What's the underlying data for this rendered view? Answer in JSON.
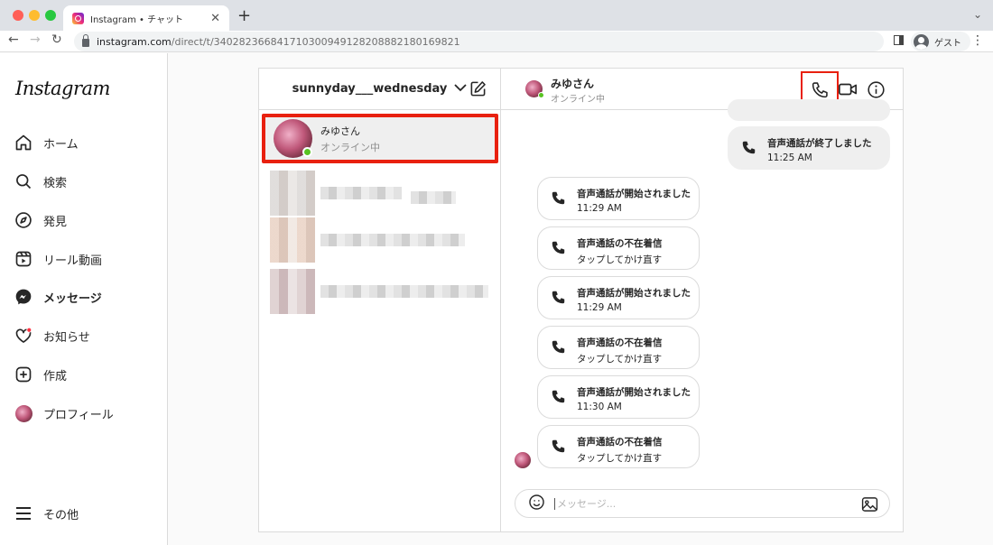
{
  "browser": {
    "tab_title": "Instagram • チャット",
    "tab_close": "✕",
    "new_tab": "+",
    "url_host": "instagram.com",
    "url_path": "/direct/t/340282366841710300949128208882180169821",
    "guest_label": "ゲスト"
  },
  "nav": {
    "logo": "Instagram",
    "items": [
      {
        "label": "ホーム",
        "icon": "home-icon"
      },
      {
        "label": "検索",
        "icon": "search-icon"
      },
      {
        "label": "発見",
        "icon": "compass-icon"
      },
      {
        "label": "リール動画",
        "icon": "reels-icon"
      },
      {
        "label": "メッセージ",
        "icon": "messenger-icon"
      },
      {
        "label": "お知らせ",
        "icon": "heart-icon"
      },
      {
        "label": "作成",
        "icon": "plus-square-icon"
      },
      {
        "label": "プロフィール",
        "icon": "profile-avatar"
      }
    ],
    "more_label": "その他"
  },
  "inbox": {
    "username": "sunnyday___wednesday",
    "threads": [
      {
        "name": "みゆさん",
        "status": "オンライン中"
      }
    ]
  },
  "chat": {
    "name": "みゆさん",
    "status": "オンライン中",
    "messages": [
      {
        "side": "right",
        "title": "音声通話が終了しました",
        "sub": "11:25 AM"
      },
      {
        "side": "left",
        "title": "音声通話が開始されました",
        "sub": "11:29 AM"
      },
      {
        "side": "left",
        "title": "音声通話の不在着信",
        "sub": "タップしてかけ直す"
      },
      {
        "side": "left",
        "title": "音声通話が開始されました",
        "sub": "11:29 AM"
      },
      {
        "side": "left",
        "title": "音声通話の不在着信",
        "sub": "タップしてかけ直す"
      },
      {
        "side": "left",
        "title": "音声通話が開始されました",
        "sub": "11:30 AM"
      },
      {
        "side": "left",
        "title": "音声通話の不在着信",
        "sub": "タップしてかけ直す"
      }
    ],
    "composer_placeholder": "メッセージ..."
  },
  "colors": {
    "highlight": "#e8200f",
    "online": "#58c322"
  }
}
